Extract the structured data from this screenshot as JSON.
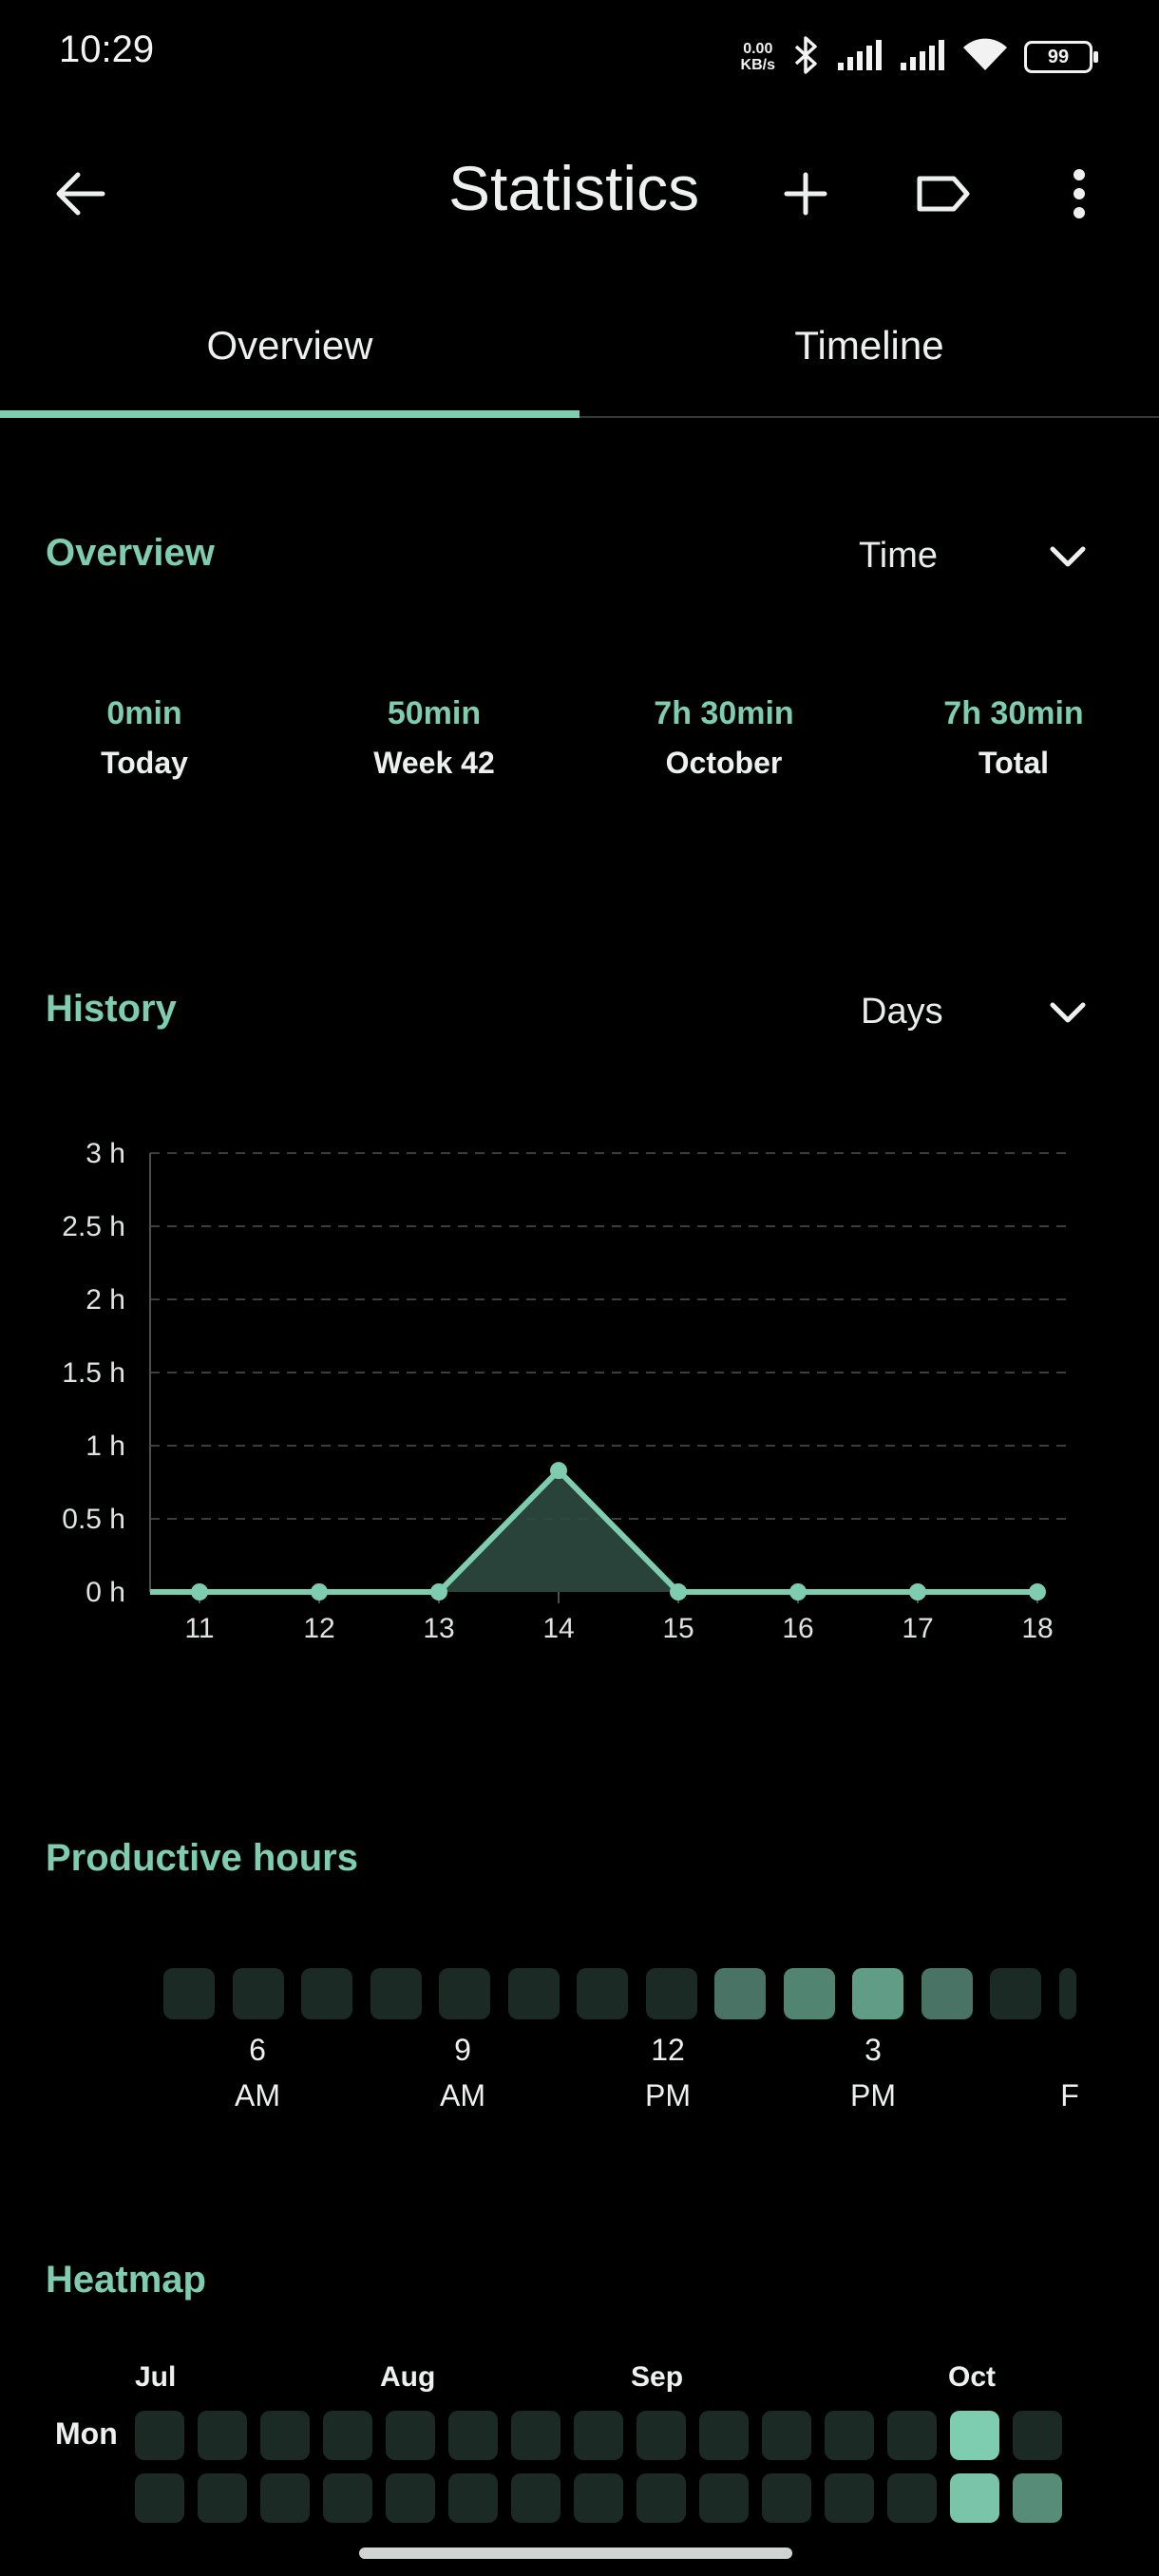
{
  "status_bar": {
    "time": "10:29",
    "net_speed_value": "0.00",
    "net_speed_unit": "KB/s",
    "battery": "99",
    "icons": [
      "bluetooth-icon",
      "signal-icon",
      "signal-icon",
      "wifi-icon",
      "battery-icon"
    ]
  },
  "app_bar": {
    "title": "Statistics",
    "actions": [
      "back-arrow-icon",
      "add-icon",
      "tag-icon",
      "more-vert-icon"
    ]
  },
  "tabs": [
    {
      "label": "Overview",
      "selected": true
    },
    {
      "label": "Timeline",
      "selected": false
    }
  ],
  "overview": {
    "title": "Overview",
    "dropdown": "Time",
    "stats": [
      {
        "value": "0min",
        "label": "Today"
      },
      {
        "value": "50min",
        "label": "Week 42"
      },
      {
        "value": "7h 30min",
        "label": "October"
      },
      {
        "value": "7h 30min",
        "label": "Total"
      }
    ]
  },
  "history": {
    "title": "History",
    "dropdown": "Days"
  },
  "chart_data": {
    "type": "area",
    "x": [
      "11",
      "12",
      "13",
      "14",
      "15",
      "16",
      "17",
      "18"
    ],
    "values": [
      0,
      0,
      0,
      0.83,
      0,
      0,
      0,
      0
    ],
    "y_ticks": [
      "0 h",
      "0.5 h",
      "1 h",
      "1.5 h",
      "2 h",
      "2.5 h",
      "3 h"
    ],
    "ylim": [
      0,
      3
    ],
    "grid": true,
    "color": "#7fcdb1"
  },
  "productive_hours": {
    "title": "Productive hours",
    "levels": [
      0.1,
      0.1,
      0.1,
      0.1,
      0.1,
      0.1,
      0.1,
      0.1,
      0.45,
      0.55,
      0.7,
      0.45,
      0.1,
      0.1
    ],
    "labels": [
      {
        "hour": "6",
        "period": "AM"
      },
      {
        "hour": "9",
        "period": "AM"
      },
      {
        "hour": "12",
        "period": "PM"
      },
      {
        "hour": "3",
        "period": "PM"
      },
      {
        "hour": "",
        "period": "F"
      }
    ]
  },
  "heatmap": {
    "title": "Heatmap",
    "months": [
      "Jul",
      "Aug",
      "Sep",
      "Oct"
    ],
    "day_label": "Mon",
    "rows": [
      [
        0.1,
        0.1,
        0.1,
        0.1,
        0.1,
        0.1,
        0.1,
        0.1,
        0.1,
        0.1,
        0.1,
        0.1,
        0.1,
        1.0,
        0.1
      ],
      [
        0.1,
        0.1,
        0.1,
        0.1,
        0.1,
        0.1,
        0.1,
        0.1,
        0.1,
        0.1,
        0.1,
        0.1,
        0.1,
        0.95,
        0.6
      ]
    ]
  },
  "colors": {
    "accent": "#7fcdb1",
    "cell_empty": "#1c2a26",
    "background": "#000000"
  }
}
